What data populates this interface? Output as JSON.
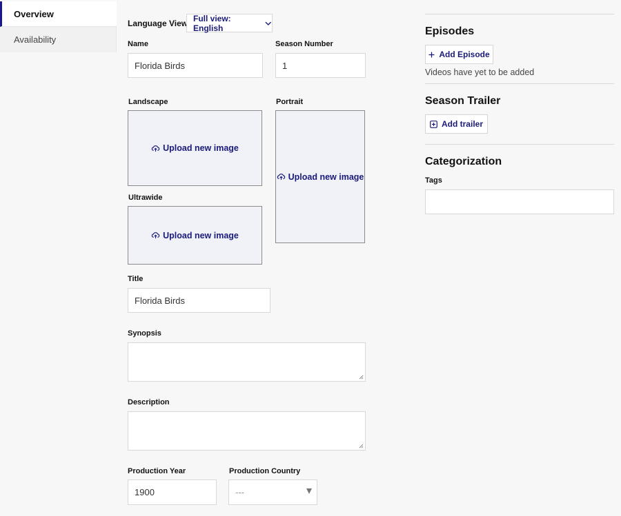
{
  "sidebar": {
    "items": [
      {
        "label": "Overview",
        "active": true
      },
      {
        "label": "Availability",
        "active": false
      }
    ]
  },
  "language_view": {
    "label": "Language View",
    "selected": "Full view: English"
  },
  "fields": {
    "name_label": "Name",
    "name_value": "Florida Birds",
    "season_label": "Season Number",
    "season_value": "1",
    "landscape_label": "Landscape",
    "portrait_label": "Portrait",
    "ultrawide_label": "Ultrawide",
    "upload_text": "Upload new image",
    "title_label": "Title",
    "title_value": "Florida Birds",
    "synopsis_label": "Synopsis",
    "description_label": "Description",
    "production_year_label": "Production Year",
    "production_year_value": "1900",
    "production_country_label": "Production Country",
    "production_country_value": "---"
  },
  "episodes": {
    "heading": "Episodes",
    "add_label": "Add Episode",
    "empty_text": "Videos have yet to be added"
  },
  "trailer": {
    "heading": "Season Trailer",
    "add_label": "Add trailer"
  },
  "categorization": {
    "heading": "Categorization",
    "tags_label": "Tags"
  },
  "colors": {
    "accent": "#1a1a7a",
    "active_border": "#1a1a8c",
    "upload_bg": "#f0f2f8"
  }
}
